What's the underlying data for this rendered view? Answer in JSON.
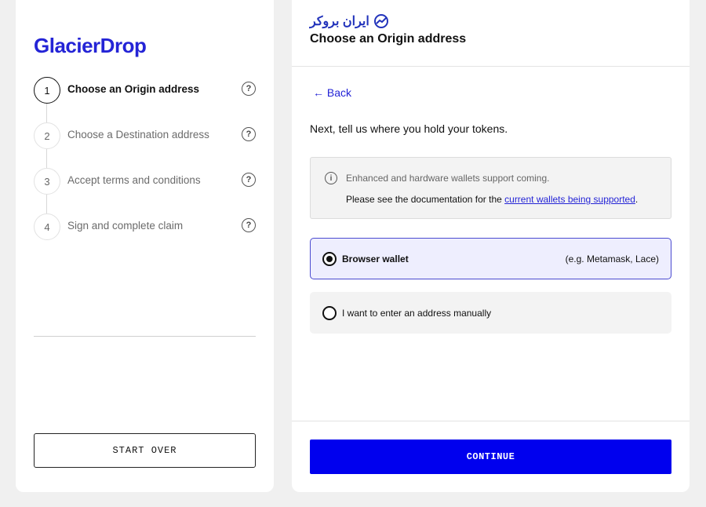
{
  "brand": {
    "logo_text": "GlacierDrop"
  },
  "watermark": {
    "text": "ایران بروکر"
  },
  "steps": [
    {
      "number": "1",
      "label": "Choose an Origin address",
      "active": true
    },
    {
      "number": "2",
      "label": "Choose a Destination address",
      "active": false
    },
    {
      "number": "3",
      "label": "Accept terms and conditions",
      "active": false
    },
    {
      "number": "4",
      "label": "Sign and complete claim",
      "active": false
    }
  ],
  "help_icon_glyph": "?",
  "sidebar": {
    "start_over_label": "START OVER"
  },
  "main": {
    "header_title": "Choose an Origin address",
    "back_label": "← Back",
    "prompt": "Next, tell us where you hold your tokens.",
    "info": {
      "icon_glyph": "i",
      "line1": "Enhanced and hardware wallets support coming.",
      "line2_prefix": "Please see the documentation for the ",
      "line2_link": "current wallets being supported",
      "line2_suffix": "."
    },
    "options": [
      {
        "label": "Browser wallet",
        "hint": "(e.g. Metamask, Lace)",
        "selected": true
      },
      {
        "label": "I want to enter an address manually",
        "hint": "",
        "selected": false
      }
    ],
    "continue_label": "CONTINUE"
  },
  "colors": {
    "accent": "#2424d6",
    "primary_button": "#0000ee",
    "selected_option_bg": "#eeeefe",
    "page_bg": "#f0f0f0"
  }
}
